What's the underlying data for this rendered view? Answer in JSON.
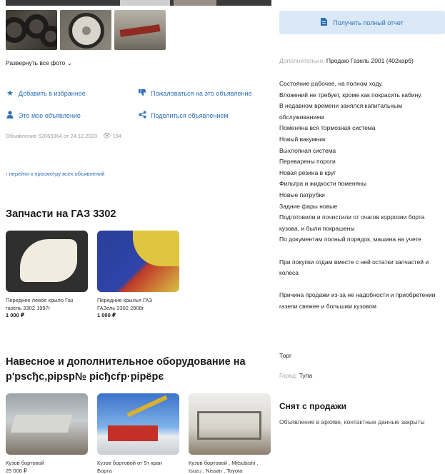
{
  "gallery": {
    "photos": [
      "tires-photo",
      "wheel-photo",
      "frame-photo"
    ],
    "expand_label": "Развернуть все фото"
  },
  "actions": {
    "favorite": "Добавить в избранное",
    "complain": "Пожаловаться на это объявление",
    "my_ad": "Это мое объявление",
    "share": "Поделиться объявлением"
  },
  "meta": {
    "published": "Объявление 52063364 от 24.12.2023",
    "views": "194"
  },
  "back_link": "перейти к просмотру всех объявлений",
  "parts_section": {
    "title": "Запчасти на ГАЗ 3302",
    "items": [
      {
        "name_line1": "Переднее левое крыло Газ",
        "name_line2": "газель 3302 1997г",
        "price": "1 000 ₽"
      },
      {
        "name_line1": "Передние крылья ГАЗ",
        "name_line2": "ГАЗель 3302 2008г",
        "price": "1 000 ₽"
      }
    ]
  },
  "equipment_section": {
    "title_line1": "Навесное и дополнительное оборудование на",
    "title_line2": "р'рѕсђс‚рірѕр№ рісђсѓр·рірёрє",
    "items": [
      {
        "name_line1": "Кузов бортовой",
        "name_line2": "25 000 ₽"
      },
      {
        "name_line1": "Кузов бортовой от 5т кран",
        "name_line2": "Борта"
      },
      {
        "name_line1": "Кузов бортовой , Mitsubishi ,",
        "name_line2": "Isuzu , Nissan , Toyota"
      }
    ]
  },
  "report_button": "Получить полный отчет",
  "additional": {
    "label": "Дополнительно:",
    "value": "Продаю Газель 2001 (402карб)"
  },
  "description": [
    "Состояние рабочее, на полном ходу.",
    "Вложений не требует, кроме как покрасить кабину.",
    "В недавном времени занялся капитальным обслуживанием",
    "Поменяна вся тормозная система",
    "Новый вакумник",
    "Выхлопная система",
    "Переварены пороги",
    "Новая резина в круг",
    "Фильтра и жидкости поменяны",
    "Новые патрубки",
    "Задние фары новые",
    "Подготовили и почистили от очагов коррозии борта кузова, и были покрашены",
    "По документам полный порядок, машина на учете",
    "",
    "При покупки отдам вместе с ней остатки запчастей и колеса",
    "",
    "Причина продажи из-за не надобности и приобретении газели свежее и большим кузовом"
  ],
  "trade": "Торг",
  "city": {
    "label": "Город:",
    "value": "Тула"
  },
  "removed": {
    "title": "Снят с продажи",
    "text": "Объявление в архиве, контактные данные закрыты"
  }
}
